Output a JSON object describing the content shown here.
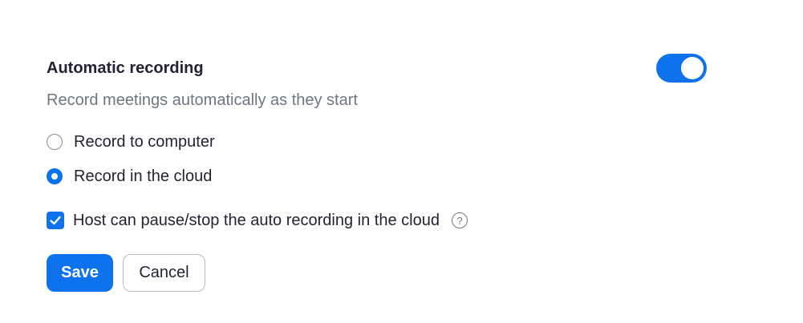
{
  "colors": {
    "accent": "#0e72ed",
    "title_text": "#232333",
    "muted_text": "#6e7680"
  },
  "setting": {
    "title": "Automatic recording",
    "description": "Record meetings automatically as they start",
    "enabled": true,
    "toggle_icon": "toggle-switch-on-icon"
  },
  "options": {
    "record_to_computer": {
      "label": "Record to computer",
      "checked": false
    },
    "record_in_cloud": {
      "label": "Record in the cloud",
      "checked": true
    }
  },
  "host_pause": {
    "label": "Host can pause/stop the auto recording in the cloud",
    "checked": true,
    "help_icon": "question-circle-icon",
    "help_glyph": "?"
  },
  "buttons": {
    "save": "Save",
    "cancel": "Cancel"
  }
}
